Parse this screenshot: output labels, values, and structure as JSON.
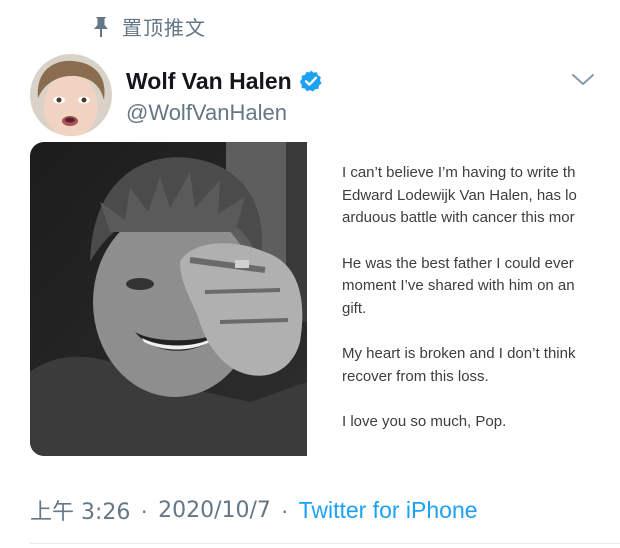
{
  "pinned": {
    "label": "置顶推文",
    "icon": "pin-icon"
  },
  "author": {
    "display_name": "Wolf Van Halen",
    "handle": "@WolfVanHalen",
    "verified": true,
    "avatar_icon": "avatar"
  },
  "media": {
    "photo_description_icon": "photo",
    "note_paragraphs": [
      {
        "lines": [
          "I can’t believe I’m having to write th",
          "Edward Lodewijk Van Halen, has lo",
          "arduous battle with cancer this mor"
        ]
      },
      {
        "lines": [
          "He was the best father I could ever",
          "moment I’ve shared with him on an",
          "gift."
        ]
      },
      {
        "lines": [
          "My heart is broken and I don’t think",
          "recover from this loss."
        ]
      },
      {
        "lines": [
          "I love you so much, Pop."
        ]
      }
    ]
  },
  "meta": {
    "time": "上午 3:26",
    "separator1": "·",
    "date": "2020/10/7",
    "separator2": "·",
    "source": "Twitter for iPhone"
  },
  "colors": {
    "accent": "#1da1f2",
    "muted": "#657786",
    "text": "#14171a"
  }
}
